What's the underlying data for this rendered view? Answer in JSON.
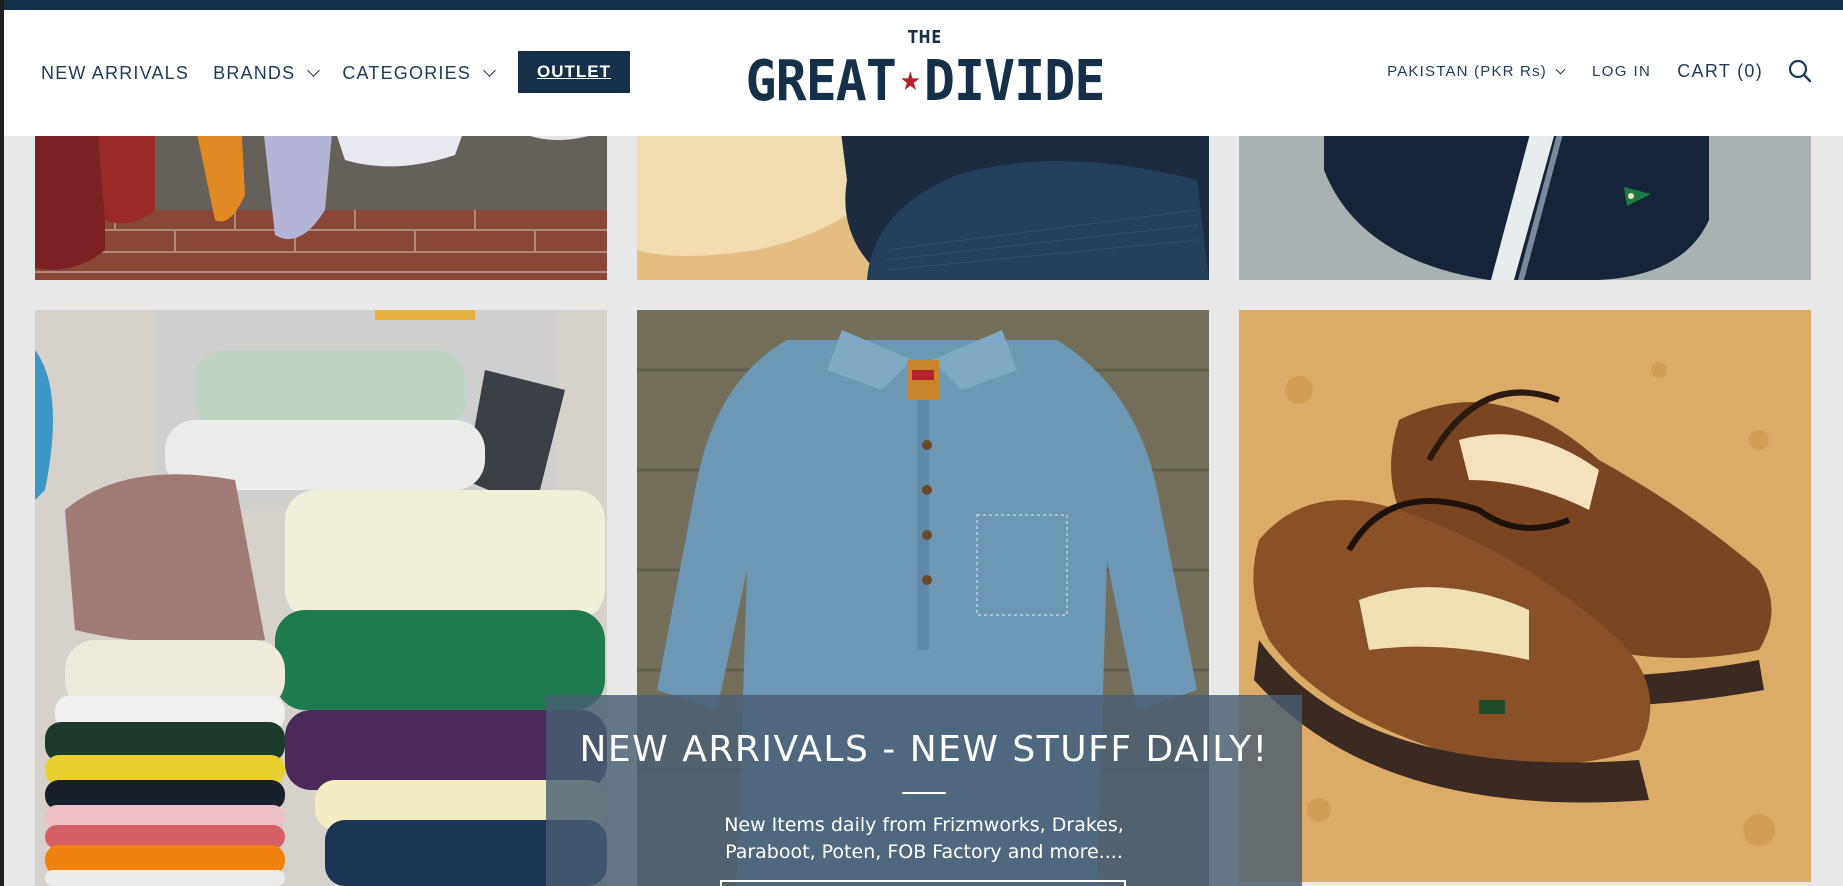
{
  "header": {
    "nav_left": [
      {
        "label": "NEW ARRIVALS",
        "has_dropdown": false
      },
      {
        "label": "BRANDS",
        "has_dropdown": true
      },
      {
        "label": "CATEGORIES",
        "has_dropdown": true
      }
    ],
    "outlet_label": "OUTLET",
    "logo": {
      "top": "THE",
      "left_word": "GREAT",
      "star": "★",
      "right_word": "DIVIDE"
    },
    "currency_label": "PAKISTAN (PKR Rs)",
    "login_label": "LOG IN",
    "cart_label": "CART (0)"
  },
  "promo": {
    "title": "NEW ARRIVALS - NEW STUFF DAILY!",
    "subtitle": "New Items daily from Frizmworks, Drakes, Paraboot, Poten, FOB Factory and more...."
  },
  "colors": {
    "brand_navy": "#16304a",
    "text_navy": "#1d3a57",
    "star_red": "#b3232b",
    "promo_overlay": "#495e71"
  }
}
